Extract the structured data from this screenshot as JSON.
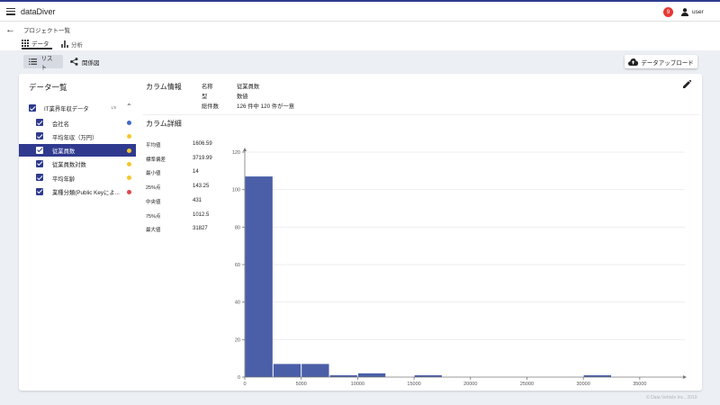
{
  "app": {
    "title": "dataDiver",
    "notification_count": "9",
    "user_label": "user"
  },
  "breadcrumb": "プロジェクト一覧",
  "tabs": [
    {
      "label": "データ"
    },
    {
      "label": "分析"
    }
  ],
  "view": {
    "list_label": "リスト",
    "relation_label": "関係図",
    "upload_label": "データアップロード"
  },
  "sidebar": {
    "title": "データ一覧",
    "dataset": {
      "name": "IT業界年収データ",
      "count": "1/6"
    },
    "columns": [
      {
        "label": "会社名",
        "dot_color": "#3f68c9"
      },
      {
        "label": "平均年収（万円）",
        "dot_color": "#f5c62b"
      },
      {
        "label": "従業員数",
        "dot_color": "#f5c62b"
      },
      {
        "label": "従業員数対数",
        "dot_color": "#f5c62b"
      },
      {
        "label": "平均年齢",
        "dot_color": "#f5c62b"
      },
      {
        "label": "業種分類(Public Keyによ...",
        "dot_color": "#e0464b"
      }
    ],
    "selected_index": 2
  },
  "column_info": {
    "title": "カラム情報",
    "rows": [
      {
        "key": "名称",
        "value": "従業員数"
      },
      {
        "key": "型",
        "value": "数値"
      },
      {
        "key": "総件数",
        "value": "126 件中 120 件が一意"
      }
    ]
  },
  "column_detail": {
    "title": "カラム詳細",
    "stats": [
      {
        "key": "平均値",
        "value": "1606.59"
      },
      {
        "key": "標準偏差",
        "value": "3719.99"
      },
      {
        "key": "最小値",
        "value": "14"
      },
      {
        "key": "25%点",
        "value": "143.25"
      },
      {
        "key": "中央値",
        "value": "431"
      },
      {
        "key": "75%点",
        "value": "1012.5"
      },
      {
        "key": "最大値",
        "value": "31827"
      }
    ]
  },
  "chart_data": {
    "type": "bar",
    "title": "",
    "xlabel": "",
    "ylabel": "",
    "bin_width": 2500,
    "bins": [
      {
        "x0": 0,
        "x1": 2500,
        "count": 107
      },
      {
        "x0": 2500,
        "x1": 5000,
        "count": 7
      },
      {
        "x0": 5000,
        "x1": 7500,
        "count": 7
      },
      {
        "x0": 7500,
        "x1": 10000,
        "count": 1
      },
      {
        "x0": 10000,
        "x1": 12500,
        "count": 2
      },
      {
        "x0": 12500,
        "x1": 15000,
        "count": 0
      },
      {
        "x0": 15000,
        "x1": 17500,
        "count": 1
      },
      {
        "x0": 17500,
        "x1": 20000,
        "count": 0
      },
      {
        "x0": 20000,
        "x1": 22500,
        "count": 0
      },
      {
        "x0": 22500,
        "x1": 25000,
        "count": 0
      },
      {
        "x0": 25000,
        "x1": 27500,
        "count": 0
      },
      {
        "x0": 27500,
        "x1": 30000,
        "count": 0
      },
      {
        "x0": 30000,
        "x1": 32500,
        "count": 1
      }
    ],
    "xlim": [
      0,
      39000
    ],
    "ylim": [
      0,
      120
    ],
    "x_ticks": [
      0,
      5000,
      10000,
      15000,
      20000,
      25000,
      30000,
      35000
    ],
    "y_ticks": [
      0,
      20,
      40,
      60,
      80,
      100,
      120
    ],
    "bar_color": "#4a5fa8",
    "grid": true
  },
  "footer": "© Data Vehicle Inc., 2019"
}
